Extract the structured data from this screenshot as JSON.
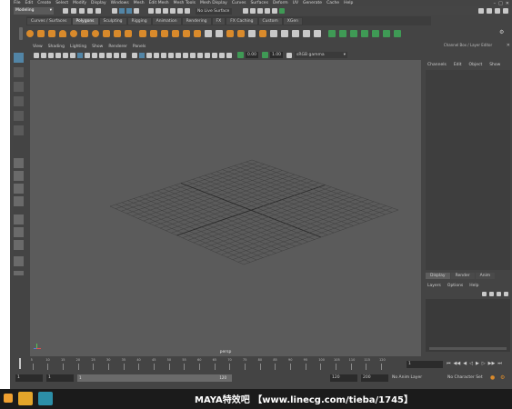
{
  "menubar": [
    "File",
    "Edit",
    "Create",
    "Select",
    "Modify",
    "Display",
    "Windows",
    "Mesh",
    "Edit Mesh",
    "Mesh Tools",
    "Mesh Display",
    "Curves",
    "Surfaces",
    "Deform",
    "UV",
    "Generate",
    "Cache",
    "Help"
  ],
  "status": {
    "mode_select": "Modeling",
    "live_surface": "No Live Surface"
  },
  "shelf_tabs": [
    {
      "label": "Curves / Surfaces",
      "active": false
    },
    {
      "label": "Polygons",
      "active": true
    },
    {
      "label": "Sculpting",
      "active": false
    },
    {
      "label": "Rigging",
      "active": false
    },
    {
      "label": "Animation",
      "active": false
    },
    {
      "label": "Rendering",
      "active": false
    },
    {
      "label": "FX",
      "active": false
    },
    {
      "label": "FX Caching",
      "active": false
    },
    {
      "label": "Custom",
      "active": false
    },
    {
      "label": "XGen",
      "active": false
    }
  ],
  "viewport_menu": [
    "View",
    "Shading",
    "Lighting",
    "Show",
    "Renderer",
    "Panels"
  ],
  "viewport_toolbar": {
    "value_a": "0.00",
    "value_b": "1.00",
    "color_space": "sRGB gamma"
  },
  "viewport": {
    "camera_label": "persp"
  },
  "channel_box": {
    "title": "Channel Box / Layer Editor",
    "menu": [
      "Channels",
      "Edit",
      "Object",
      "Show"
    ]
  },
  "layer_editor": {
    "tabs": [
      "Display",
      "Render",
      "Anim"
    ],
    "menu": [
      "Layers",
      "Options",
      "Help"
    ]
  },
  "time_slider": {
    "ticks": [
      "5",
      "10",
      "15",
      "20",
      "25",
      "30",
      "35",
      "40",
      "45",
      "50",
      "55",
      "60",
      "65",
      "70",
      "75",
      "80",
      "85",
      "90",
      "95",
      "100",
      "105",
      "110",
      "115",
      "120"
    ],
    "current_frame": "1"
  },
  "range_slider": {
    "start": "1",
    "playback_start": "1",
    "playback_start_b": "1",
    "playback_end": "120",
    "end": "120",
    "anim_end": "200",
    "anim_layer": "No Anim Layer",
    "char_set": "No Character Set"
  },
  "watermark": "MAYA特效吧  【www.linecg.com/tieba/1745】",
  "colors": {
    "accent_green": "#3f9a55",
    "icon_orange": "#d98a2b",
    "select_blue": "#5285a6"
  }
}
